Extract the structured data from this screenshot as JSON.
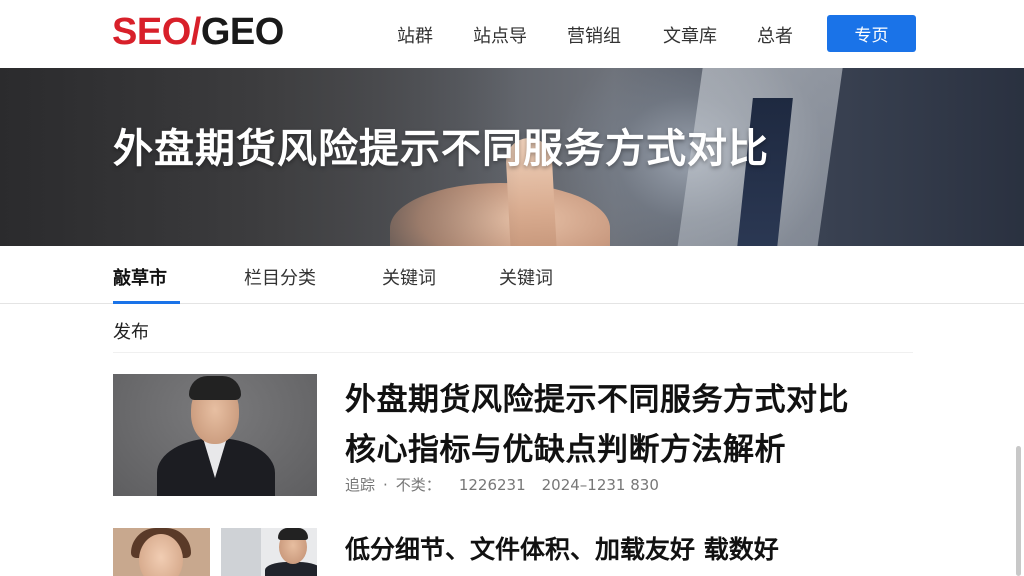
{
  "header": {
    "logo_red": "SEO/",
    "logo_black": "GEO",
    "nav": [
      "站群",
      "站点导",
      "营销组",
      "文章库",
      "总者"
    ],
    "nav_button": "专页"
  },
  "hero": {
    "title": "外盘期货风险提示不同服务方式对比"
  },
  "tabs": {
    "items": [
      "敲草市",
      "栏目分类",
      "关键词",
      "关键词"
    ],
    "active_index": 0
  },
  "section": {
    "label": "发布"
  },
  "articles": [
    {
      "title_line1": "外盘期货风险提示不同服务方式对比",
      "title_line2": "核心指标与优缺点判断方法解析",
      "meta_source": "追踪",
      "meta_sep": "·",
      "meta_type": "不类：",
      "meta_id": "1226231",
      "meta_date": "2024–1231 830"
    },
    {
      "title": "低分细节、文件体积、加载友好 载数好"
    }
  ],
  "colors": {
    "accent": "#1a73e8",
    "logo_red": "#d8202a"
  }
}
